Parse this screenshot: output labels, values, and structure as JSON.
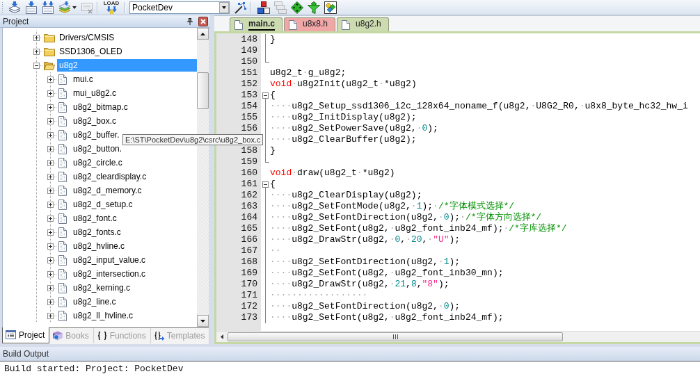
{
  "toolbar": {
    "groups": [
      {
        "buttons": [
          {
            "kind": "stack",
            "disabled": false
          },
          {
            "kind": "build",
            "disabled": false
          },
          {
            "kind": "rebuild",
            "disabled": false
          },
          {
            "kind": "batch",
            "disabled": false
          },
          {
            "kind": "stop",
            "disabled": true
          }
        ]
      },
      {
        "buttons": [
          {
            "kind": "load",
            "label": "LOAD",
            "disabled": false
          }
        ]
      },
      {
        "buttons": [
          {
            "kind": "combo",
            "value": "PocketDev",
            "disabled": false
          },
          {
            "kind": "wand",
            "disabled": false
          }
        ]
      },
      {
        "buttons": [
          {
            "kind": "blocks",
            "disabled": false
          },
          {
            "kind": "layers",
            "disabled": true
          },
          {
            "kind": "diamond",
            "disabled": false
          },
          {
            "kind": "funnel",
            "disabled": false
          },
          {
            "kind": "diamonds",
            "disabled": false
          }
        ]
      }
    ]
  },
  "project_panel": {
    "title": "Project",
    "tree": [
      {
        "label": "Drivers/CMSIS",
        "kind": "folder",
        "expanded": false,
        "selected": false
      },
      {
        "label": "SSD1306_OLED",
        "kind": "folder",
        "expanded": false,
        "selected": false
      },
      {
        "label": "u8g2",
        "kind": "folder",
        "expanded": true,
        "selected": true,
        "children": [
          {
            "label": "mui.c",
            "kind": "file",
            "expanded": false,
            "selected": false
          },
          {
            "label": "mui_u8g2.c",
            "kind": "file",
            "expanded": false,
            "selected": false
          },
          {
            "label": "u8g2_bitmap.c",
            "kind": "file",
            "expanded": false,
            "selected": false
          },
          {
            "label": "u8g2_box.c",
            "kind": "file",
            "expanded": false,
            "selected": false
          },
          {
            "label": "u8g2_buffer.",
            "kind": "file",
            "expanded": false,
            "selected": false
          },
          {
            "label": "u8g2_button.",
            "kind": "file",
            "expanded": false,
            "selected": false
          },
          {
            "label": "u8g2_circle.c",
            "kind": "file",
            "expanded": false,
            "selected": false
          },
          {
            "label": "u8g2_cleardisplay.c",
            "kind": "file",
            "expanded": false,
            "selected": false
          },
          {
            "label": "u8g2_d_memory.c",
            "kind": "file",
            "expanded": false,
            "selected": false
          },
          {
            "label": "u8g2_d_setup.c",
            "kind": "file",
            "expanded": false,
            "selected": false
          },
          {
            "label": "u8g2_font.c",
            "kind": "file",
            "expanded": false,
            "selected": false
          },
          {
            "label": "u8g2_fonts.c",
            "kind": "file",
            "expanded": false,
            "selected": false
          },
          {
            "label": "u8g2_hvline.c",
            "kind": "file",
            "expanded": false,
            "selected": false
          },
          {
            "label": "u8g2_input_value.c",
            "kind": "file",
            "expanded": false,
            "selected": false
          },
          {
            "label": "u8g2_intersection.c",
            "kind": "file",
            "expanded": false,
            "selected": false
          },
          {
            "label": "u8g2_kerning.c",
            "kind": "file",
            "expanded": false,
            "selected": false
          },
          {
            "label": "u8g2_line.c",
            "kind": "file",
            "expanded": false,
            "selected": false
          },
          {
            "label": "u8g2_ll_hvline.c",
            "kind": "file",
            "expanded": false,
            "selected": false
          }
        ]
      }
    ],
    "tabs": [
      {
        "label": "Project",
        "kind": "project",
        "selected": true
      },
      {
        "label": "Books",
        "kind": "books",
        "selected": false
      },
      {
        "label": "Functions",
        "kind": "functions",
        "selected": false
      },
      {
        "label": "Templates",
        "kind": "templates",
        "selected": false
      }
    ]
  },
  "tooltip": {
    "text": "E:\\ST\\PocketDev\\u8g2\\csrc\\u8g2_box.c"
  },
  "editor": {
    "tabs": [
      {
        "label": "main.c",
        "selected": true,
        "color": "#cddbb1"
      },
      {
        "label": "u8x8.h",
        "selected": false,
        "color": "#f2a7a7"
      },
      {
        "label": "u8g2.h",
        "selected": false,
        "color": "#cddbb1"
      }
    ],
    "lines": [
      {
        "number": "148",
        "kind": "inside",
        "tokens": [
          {
            "kind": "plain",
            "text": "}"
          }
        ]
      },
      {
        "number": "149",
        "kind": "inside"
      },
      {
        "number": "150",
        "kind": "end"
      },
      {
        "number": "151",
        "kind": "plain",
        "tokens": [
          {
            "kind": "plain",
            "text": "u8g2_t"
          },
          {
            "kind": "space",
            "text": "·"
          },
          {
            "kind": "plain",
            "text": "g_u8g2;"
          }
        ]
      },
      {
        "number": "152",
        "kind": "plain",
        "tokens": [
          {
            "kind": "keyword",
            "text": "void"
          },
          {
            "kind": "space",
            "text": "·"
          },
          {
            "kind": "plain",
            "text": "u8g2Init(u8g2_t"
          },
          {
            "kind": "space",
            "text": "·"
          },
          {
            "kind": "plain",
            "text": "*u8g2)"
          }
        ]
      },
      {
        "number": "153",
        "kind": "open",
        "tokens": [
          {
            "kind": "plain",
            "text": "{"
          }
        ]
      },
      {
        "number": "154",
        "kind": "inside",
        "tokens": [
          {
            "kind": "space",
            "text": "····"
          },
          {
            "kind": "plain",
            "text": "u8g2_Setup_ssd1306_i2c_128x64_noname_f(u8g2,"
          },
          {
            "kind": "space",
            "text": "·"
          },
          {
            "kind": "plain",
            "text": "U8G2_R0,"
          },
          {
            "kind": "space",
            "text": "·"
          },
          {
            "kind": "plain",
            "text": "u8x8_byte_hc32_hw_i"
          }
        ]
      },
      {
        "number": "155",
        "kind": "inside",
        "tokens": [
          {
            "kind": "space",
            "text": "····"
          },
          {
            "kind": "plain",
            "text": "u8g2_InitDisplay(u8g2);"
          }
        ]
      },
      {
        "number": "156",
        "kind": "inside",
        "tokens": [
          {
            "kind": "space",
            "text": "····"
          },
          {
            "kind": "plain",
            "text": "u8g2_SetPowerSave(u8g2,"
          },
          {
            "kind": "space",
            "text": "·"
          },
          {
            "kind": "number",
            "text": "0"
          },
          {
            "kind": "plain",
            "text": ");"
          }
        ]
      },
      {
        "kind": "inside",
        "tokens": [
          {
            "kind": "space",
            "text": "····"
          },
          {
            "kind": "plain",
            "text": "u8g2_ClearBuffer(u8g2);"
          }
        ]
      },
      {
        "number": "158",
        "kind": "inside",
        "tokens": [
          {
            "kind": "plain",
            "text": "}"
          }
        ]
      },
      {
        "number": "159",
        "kind": "end"
      },
      {
        "number": "160",
        "kind": "plain",
        "tokens": [
          {
            "kind": "keyword",
            "text": "void"
          },
          {
            "kind": "space",
            "text": "·"
          },
          {
            "kind": "plain",
            "text": "draw(u8g2_t"
          },
          {
            "kind": "space",
            "text": "·"
          },
          {
            "kind": "plain",
            "text": "*u8g2)"
          }
        ]
      },
      {
        "number": "161",
        "kind": "open",
        "tokens": [
          {
            "kind": "plain",
            "text": "{"
          }
        ]
      },
      {
        "number": "162",
        "kind": "inside",
        "tokens": [
          {
            "kind": "space",
            "text": "····"
          },
          {
            "kind": "plain",
            "text": "u8g2_ClearDisplay(u8g2);"
          }
        ]
      },
      {
        "number": "163",
        "kind": "inside",
        "tokens": [
          {
            "kind": "space",
            "text": "····"
          },
          {
            "kind": "plain",
            "text": "u8g2_SetFontMode(u8g2,"
          },
          {
            "kind": "space",
            "text": "·"
          },
          {
            "kind": "number",
            "text": "1"
          },
          {
            "kind": "plain",
            "text": ");"
          },
          {
            "kind": "space",
            "text": "·"
          },
          {
            "kind": "comment",
            "text": "/*字体模式选择*/"
          }
        ]
      },
      {
        "number": "164",
        "kind": "inside",
        "tokens": [
          {
            "kind": "space",
            "text": "····"
          },
          {
            "kind": "plain",
            "text": "u8g2_SetFontDirection(u8g2,"
          },
          {
            "kind": "space",
            "text": "·"
          },
          {
            "kind": "number",
            "text": "0"
          },
          {
            "kind": "plain",
            "text": ");"
          },
          {
            "kind": "space",
            "text": "·"
          },
          {
            "kind": "comment",
            "text": "/*字体方向选择*/"
          }
        ]
      },
      {
        "number": "165",
        "kind": "inside",
        "tokens": [
          {
            "kind": "space",
            "text": "····"
          },
          {
            "kind": "plain",
            "text": "u8g2_SetFont(u8g2,"
          },
          {
            "kind": "space",
            "text": "·"
          },
          {
            "kind": "plain",
            "text": "u8g2_font_inb24_mf);"
          },
          {
            "kind": "space",
            "text": "·"
          },
          {
            "kind": "comment",
            "text": "/*字库选择*/"
          }
        ]
      },
      {
        "number": "166",
        "kind": "inside",
        "tokens": [
          {
            "kind": "space",
            "text": "····"
          },
          {
            "kind": "plain",
            "text": "u8g2_DrawStr(u8g2,"
          },
          {
            "kind": "space",
            "text": "·"
          },
          {
            "kind": "number",
            "text": "0"
          },
          {
            "kind": "plain",
            "text": ","
          },
          {
            "kind": "space",
            "text": "·"
          },
          {
            "kind": "number",
            "text": "20"
          },
          {
            "kind": "plain",
            "text": ","
          },
          {
            "kind": "space",
            "text": "·"
          },
          {
            "kind": "string",
            "text": "\"U\""
          },
          {
            "kind": "plain",
            "text": ");"
          }
        ]
      },
      {
        "number": "167",
        "kind": "inside",
        "tokens": [
          {
            "kind": "space",
            "text": "··"
          }
        ]
      },
      {
        "number": "168",
        "kind": "inside",
        "tokens": [
          {
            "kind": "space",
            "text": "····"
          },
          {
            "kind": "plain",
            "text": "u8g2_SetFontDirection(u8g2,"
          },
          {
            "kind": "space",
            "text": "·"
          },
          {
            "kind": "number",
            "text": "1"
          },
          {
            "kind": "plain",
            "text": ");"
          }
        ]
      },
      {
        "number": "169",
        "kind": "inside",
        "tokens": [
          {
            "kind": "space",
            "text": "····"
          },
          {
            "kind": "plain",
            "text": "u8g2_SetFont(u8g2,"
          },
          {
            "kind": "space",
            "text": "·"
          },
          {
            "kind": "plain",
            "text": "u8g2_font_inb30_mn);"
          }
        ]
      },
      {
        "number": "170",
        "kind": "inside",
        "tokens": [
          {
            "kind": "space",
            "text": "····"
          },
          {
            "kind": "plain",
            "text": "u8g2_DrawStr(u8g2,"
          },
          {
            "kind": "space",
            "text": "·"
          },
          {
            "kind": "number",
            "text": "21"
          },
          {
            "kind": "plain",
            "text": ","
          },
          {
            "kind": "number",
            "text": "8"
          },
          {
            "kind": "plain",
            "text": ","
          },
          {
            "kind": "string",
            "text": "\"8\""
          },
          {
            "kind": "plain",
            "text": ");"
          }
        ]
      },
      {
        "number": "171",
        "kind": "inside",
        "tokens": [
          {
            "kind": "space",
            "text": "··················"
          }
        ]
      },
      {
        "number": "172",
        "kind": "inside",
        "tokens": [
          {
            "kind": "space",
            "text": "····"
          },
          {
            "kind": "plain",
            "text": "u8g2_SetFontDirection(u8g2,"
          },
          {
            "kind": "space",
            "text": "·"
          },
          {
            "kind": "number",
            "text": "0"
          },
          {
            "kind": "plain",
            "text": ");"
          }
        ]
      },
      {
        "number": "173",
        "kind": "inside",
        "tokens": [
          {
            "kind": "space",
            "text": "····"
          },
          {
            "kind": "plain",
            "text": "u8g2_SetFont(u8g2,"
          },
          {
            "kind": "space",
            "text": "·"
          },
          {
            "kind": "plain",
            "text": "u8g2_font_inb24_mf);"
          }
        ]
      }
    ]
  },
  "build_output": {
    "title": "Build Output",
    "lines": [
      "Build started: Project: PocketDev"
    ]
  }
}
